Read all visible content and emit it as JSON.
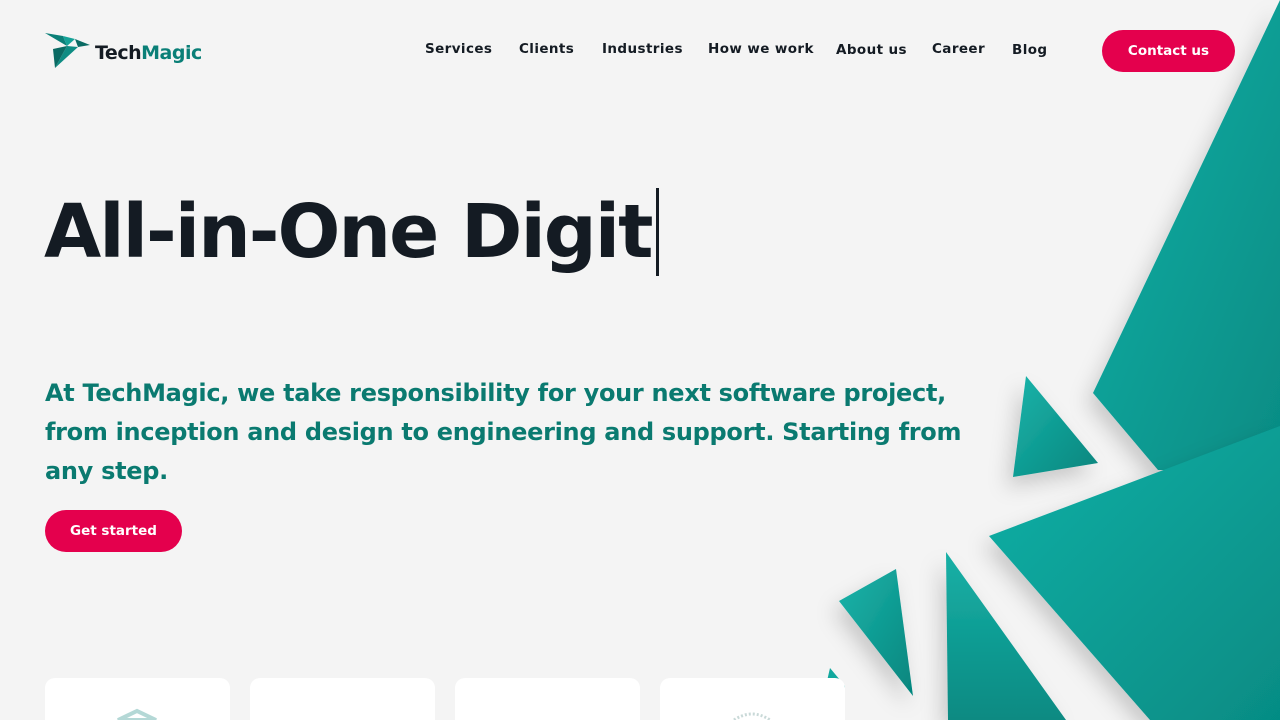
{
  "brand": {
    "name_part1": "Tech",
    "name_part2": "Magic",
    "accent": "#0a7f77",
    "cta_color": "#e4004d"
  },
  "nav": {
    "items": [
      {
        "label": "Services"
      },
      {
        "label": "Clients"
      },
      {
        "label": "Industries"
      },
      {
        "label": "How we work"
      },
      {
        "label": "About us"
      },
      {
        "label": "Career"
      },
      {
        "label": "Blog"
      }
    ],
    "contact_label": "Contact us"
  },
  "hero": {
    "title_typed": "All-in-One Digit",
    "subtitle": "At TechMagic, we take responsibility for your next software project, from inception and design to engineering and support. Starting from any step.",
    "cta_label": "Get started"
  },
  "badges": {
    "icons": [
      "shield-badge-icon",
      "blank",
      "blank",
      "seal-badge-icon"
    ]
  }
}
